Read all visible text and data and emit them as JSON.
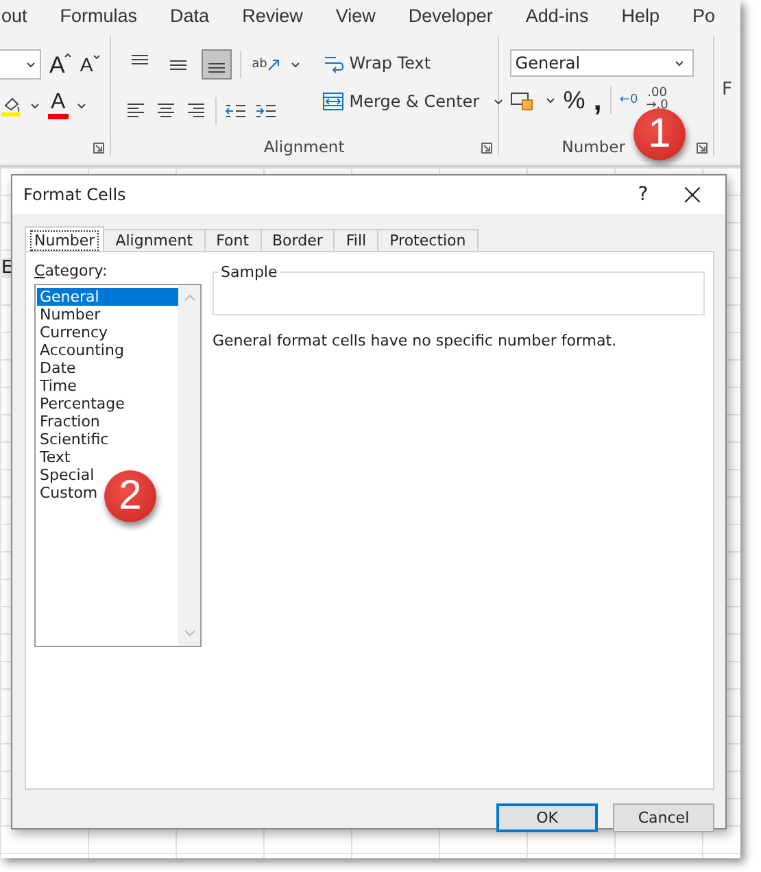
{
  "ribbon_tabs": [
    "out",
    "Formulas",
    "Data",
    "Review",
    "View",
    "Developer",
    "Add-ins",
    "Help",
    "Po"
  ],
  "font_group": {
    "grow_font": "A",
    "shrink_font": "A",
    "font_color": "A"
  },
  "alignment_group": {
    "label": "Alignment",
    "orientation": "ab",
    "wrap_text": "Wrap Text",
    "merge_center": "Merge & Center",
    "align_buttons": [
      {
        "kind": "top",
        "selected": false
      },
      {
        "kind": "middle",
        "selected": false
      },
      {
        "kind": "bottom",
        "selected": true
      }
    ]
  },
  "number_group": {
    "label": "Number",
    "format": "General",
    "percent": "%",
    "comma": ",",
    "increase_decimal": "←0",
    "decrease_decimal_top": ".00",
    "decrease_decimal_bottom": "→.0"
  },
  "next_group_partial": "F",
  "sheet": {
    "column_header_partial": "E"
  },
  "dialog": {
    "title": "Format Cells",
    "help": "?",
    "close": "×",
    "tabs": [
      {
        "label": "Number",
        "selected": true
      },
      {
        "label": "Alignment",
        "selected": false
      },
      {
        "label": "Font",
        "selected": false
      },
      {
        "label": "Border",
        "selected": false
      },
      {
        "label": "Fill",
        "selected": false
      },
      {
        "label": "Protection",
        "selected": false
      }
    ],
    "category_label": "Category:",
    "categories": [
      {
        "label": "General",
        "selected": true
      },
      {
        "label": "Number",
        "selected": false
      },
      {
        "label": "Currency",
        "selected": false
      },
      {
        "label": "Accounting",
        "selected": false
      },
      {
        "label": "Date",
        "selected": false
      },
      {
        "label": "Time",
        "selected": false
      },
      {
        "label": "Percentage",
        "selected": false
      },
      {
        "label": "Fraction",
        "selected": false
      },
      {
        "label": "Scientific",
        "selected": false
      },
      {
        "label": "Text",
        "selected": false
      },
      {
        "label": "Special",
        "selected": false
      },
      {
        "label": "Custom",
        "selected": false
      }
    ],
    "sample_label": "Sample",
    "description": "General format cells have no specific number format.",
    "buttons": [
      {
        "label": "OK",
        "kind": "default"
      },
      {
        "label": "Cancel",
        "kind": "normal"
      }
    ]
  },
  "callouts": [
    "1",
    "2"
  ]
}
